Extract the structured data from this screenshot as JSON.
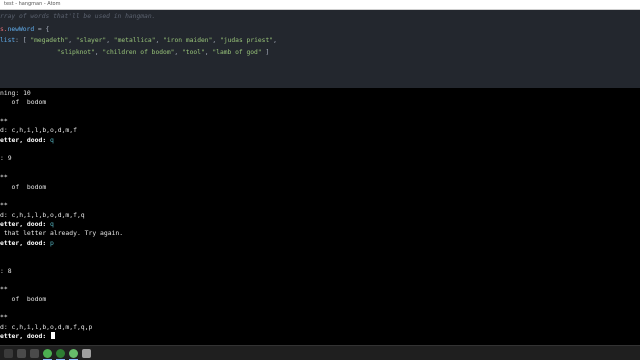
{
  "window": {
    "title": "test - hangman - Atom"
  },
  "editor": {
    "comment": "rray of words that'll be used in hangman.",
    "obj_prefix": "s.",
    "prop": "newWord",
    "assign_tail": " = {",
    "list_key": "list",
    "list_open": ": [ ",
    "words_line1": [
      "\"megadeth\"",
      "\"slayer\"",
      "\"metallica\"",
      "\"iron maiden\"",
      "\"judas priest\""
    ],
    "words_line2": [
      "\"slipknot\"",
      "\"children of bodom\"",
      "\"tool\"",
      "\"lamb of god\""
    ],
    "list_close": " ]"
  },
  "terminal": {
    "lines": [
      {
        "text": "ning: 10"
      },
      {
        "text": "   of  bodom"
      },
      {
        "text": ""
      },
      {
        "text": "**"
      },
      {
        "text": "d: c,h,i,l,b,o,d,m,f"
      },
      {
        "prompt": "etter, dood: ",
        "answer": "q"
      },
      {
        "text": ""
      },
      {
        "text": ": 9"
      },
      {
        "text": ""
      },
      {
        "text": "**"
      },
      {
        "text": "   of  bodom"
      },
      {
        "text": ""
      },
      {
        "text": "**"
      },
      {
        "text": "d: c,h,i,l,b,o,d,m,f,q"
      },
      {
        "prompt": "etter, dood: ",
        "answer": "q"
      },
      {
        "text": " that letter already. Try again."
      },
      {
        "prompt": "etter, dood: ",
        "answer": "p"
      },
      {
        "text": ""
      },
      {
        "text": ""
      },
      {
        "text": ": 8"
      },
      {
        "text": ""
      },
      {
        "text": "**"
      },
      {
        "text": "   of  bodom"
      },
      {
        "text": ""
      },
      {
        "text": "**"
      },
      {
        "text": "d: c,h,i,l,b,o,d,m,f,q,p"
      },
      {
        "prompt": "etter, dood: ",
        "answer": "",
        "cursor": true
      }
    ]
  },
  "colors": {
    "terminal_bg": "#000000",
    "editor_bg": "#23272e",
    "string": "#98c379",
    "property": "#61afef",
    "answer": "#56b6c2"
  },
  "taskbar": {
    "icons": [
      {
        "name": "windows-start-icon",
        "color": "#3a3a3a"
      },
      {
        "name": "search-icon",
        "color": "#4a4a4a"
      },
      {
        "name": "task-view-icon",
        "color": "#4a4a4a"
      },
      {
        "name": "chrome-icon",
        "color": "#4caf50"
      },
      {
        "name": "terminal-icon",
        "color": "#2e7d32"
      },
      {
        "name": "atom-icon",
        "color": "#66bb6a"
      },
      {
        "name": "app-icon",
        "color": "#9e9e9e"
      }
    ]
  }
}
